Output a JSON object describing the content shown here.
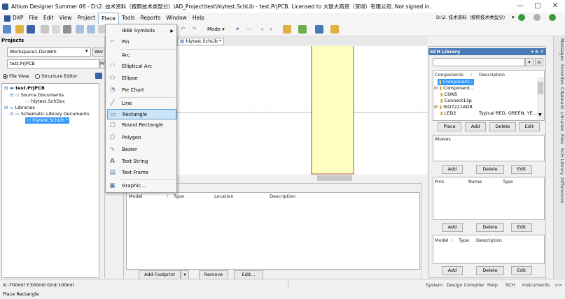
{
  "title_bar": {
    "title": "Altium Designer Summer 08 - D:\\2. 技术资料（按照技术类型分）\\AD_Project\\test\\hlytest.SchLib - test.PrjPCB. Licensed to 大联大商贸（深圳）有限公司. Not signed in.",
    "minimize": "—",
    "maximize": "□",
    "close": "✕"
  },
  "menu": {
    "items": [
      {
        "label": "DXP",
        "key": "D"
      },
      {
        "label": "File",
        "key": "F"
      },
      {
        "label": "Edit",
        "key": "E"
      },
      {
        "label": "View",
        "key": "V"
      },
      {
        "label": "Project",
        "key": "c"
      },
      {
        "label": "Place",
        "key": "P"
      },
      {
        "label": "Tools",
        "key": "T"
      },
      {
        "label": "Reports",
        "key": "R"
      },
      {
        "label": "Window",
        "key": "W"
      },
      {
        "label": "Help",
        "key": "H"
      }
    ],
    "path_combo": "D:\\2. 技术资料（按照技术类型分）"
  },
  "toolbar": {
    "mode_label": "Mode"
  },
  "place_menu": {
    "items": [
      {
        "label": "IEEE Symbols",
        "icon": "submenu"
      },
      {
        "label": "Pin",
        "icon": "pin-icon"
      },
      {
        "label": "Arc",
        "icon": "arc-icon"
      },
      {
        "label": "Elliptical Arc",
        "icon": "elliptical-arc-icon"
      },
      {
        "label": "Ellipse",
        "icon": "ellipse-icon"
      },
      {
        "label": "Pie Chart",
        "icon": "pie-chart-icon"
      },
      {
        "label": "Line",
        "icon": "line-icon"
      },
      {
        "label": "Rectangle",
        "icon": "rectangle-icon"
      },
      {
        "label": "Round Rectangle",
        "icon": "round-rectangle-icon"
      },
      {
        "label": "Polygon",
        "icon": "polygon-icon"
      },
      {
        "label": "Bezier",
        "icon": "bezier-icon"
      },
      {
        "label": "Text String",
        "icon": "text-icon"
      },
      {
        "label": "Text Frame",
        "icon": "text-frame-icon"
      },
      {
        "label": "Graphic...",
        "icon": "graphic-icon"
      }
    ],
    "highlighted": "Rectangle"
  },
  "projects_panel": {
    "title": "Projects",
    "workspace": "Workspace1.DsnWrk",
    "workspace_btn": "Wor",
    "project": "test.PrjPCB",
    "project_btn": "Pr",
    "file_view": "File View",
    "structure_editor": "Structure Editor",
    "tree": {
      "project": "test.PrjPCB",
      "source_documents": "Source Documents",
      "schdoc": "hlytest.SchDoc",
      "libraries": "Libraries",
      "schematic_library_documents": "Schematic Library Documents",
      "schlib": "hlytest.SchLib *"
    }
  },
  "document_tab": {
    "label": "hlytest.SchLib *"
  },
  "model_panel": {
    "columns": [
      "Model",
      "Type",
      "Location",
      "Description"
    ],
    "add_footprint": "Add Footprint",
    "remove": "Remove",
    "edit": "Edit..."
  },
  "sch_library": {
    "title": "SCH Library",
    "components_header": "Components",
    "description_header": "Description",
    "components": [
      {
        "name": "Component...",
        "description": "",
        "selected": true
      },
      {
        "name": "Component...",
        "description": ""
      },
      {
        "name": "CON5",
        "description": ""
      },
      {
        "name": "Connect13p",
        "description": ""
      },
      {
        "name": "ISO7221ADR",
        "description": ""
      },
      {
        "name": "LED2",
        "description": "Typical RED, GREEN, YE..."
      }
    ],
    "place": "Place",
    "add": "Add",
    "delete": "Delete",
    "edit": "Edit",
    "aliases": "Aliases",
    "pins_header": [
      "Pins",
      "Name",
      "Type"
    ],
    "model_header": [
      "Model",
      "Type",
      "Description"
    ]
  },
  "side_tabs": [
    "Messages",
    "Favorites",
    "Clipboard",
    "Libraries",
    "Files",
    "SCH Library",
    "Differences"
  ],
  "status_bar": {
    "coords": "X:-700mil Y:300mil",
    "grid": "Grid:100mil",
    "hint": "Place Rectangle",
    "buttons": [
      "System",
      "Design Compiler",
      "Help",
      "SCH",
      "Instruments",
      ">>"
    ]
  },
  "colors": {
    "component_fill": "#ffffc0",
    "component_border": "#8b0000",
    "selection": "#3399ff",
    "menu_highlight": "#cce4f7"
  }
}
